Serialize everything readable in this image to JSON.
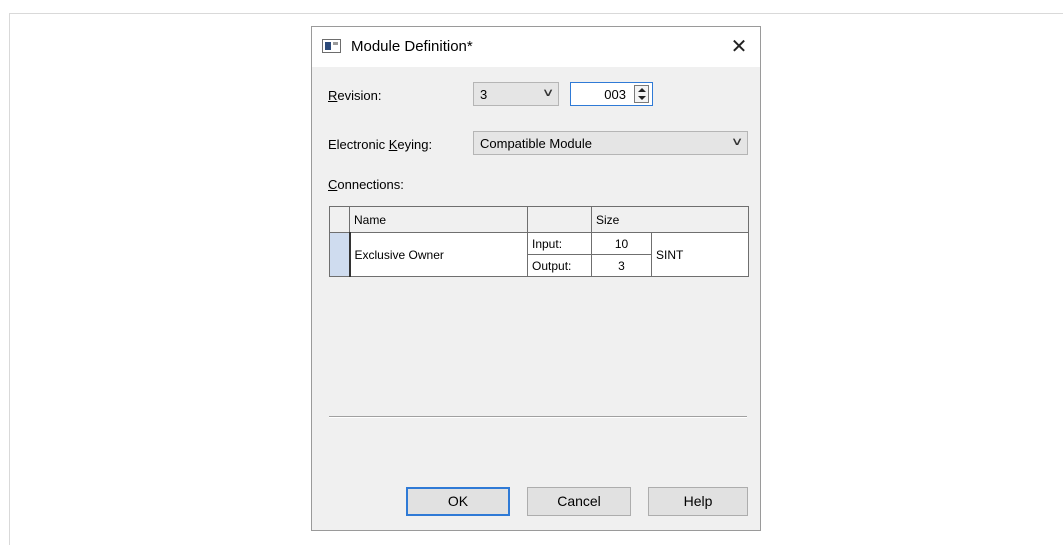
{
  "dialog": {
    "title": "Module Definition*",
    "close_label": "✕"
  },
  "revision": {
    "label_accel": "R",
    "label_rest": "evision:",
    "major_value": "3",
    "minor_value": "003"
  },
  "keying": {
    "label_pre": "Electronic ",
    "label_accel": "K",
    "label_post": "eying:",
    "value": "Compatible Module"
  },
  "connections": {
    "label_accel": "C",
    "label_rest": "onnections:",
    "columns": [
      "Name",
      "",
      "Size"
    ],
    "rows": [
      {
        "name": "Exclusive Owner",
        "input_label": "Input:",
        "input_size": "10",
        "output_label": "Output:",
        "output_size": "3",
        "type": "SINT"
      }
    ]
  },
  "buttons": {
    "ok": "OK",
    "cancel": "Cancel",
    "help": "Help"
  },
  "icons": {
    "dropdown": "chevron-down-icon",
    "close": "close-icon",
    "app": "module-icon"
  },
  "colors": {
    "accent": "#2f7ad6",
    "dialog_bg": "#f0f0f0",
    "row_selector": "#cfdcef"
  }
}
